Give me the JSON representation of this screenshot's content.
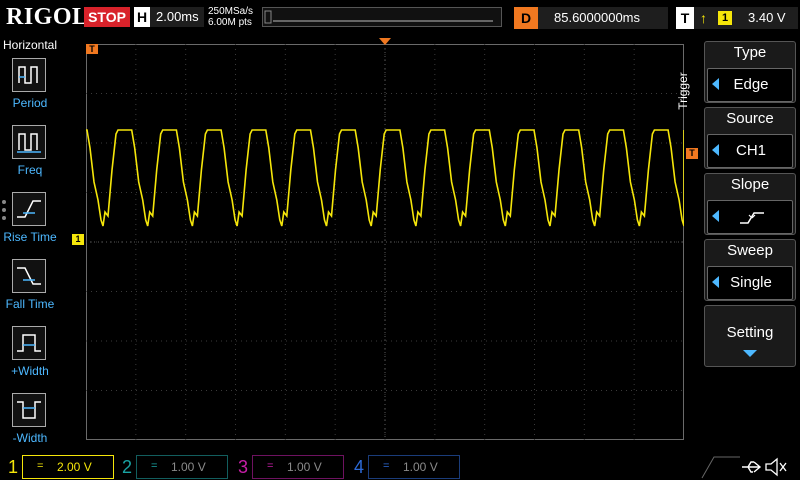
{
  "header": {
    "brand": "RIGOL",
    "run_state": "STOP",
    "horizontal_label": "H",
    "timebase": "2.00ms",
    "sample_rate": "250MSa/s",
    "memory_depth": "6.00M pts",
    "delay_label": "D",
    "delay_value": "85.6000000ms",
    "trigger_label": "T",
    "trigger_channel": "1",
    "trigger_level": "3.40 V"
  },
  "left_menu": {
    "title": "Horizontal",
    "items": [
      {
        "label": "Period",
        "icon": "period-icon"
      },
      {
        "label": "Freq",
        "icon": "frequency-icon"
      },
      {
        "label": "Rise Time",
        "icon": "rise-time-icon"
      },
      {
        "label": "Fall Time",
        "icon": "fall-time-icon"
      },
      {
        "label": "+Width",
        "icon": "positive-width-icon"
      },
      {
        "label": "-Width",
        "icon": "negative-width-icon"
      }
    ]
  },
  "right_menu": {
    "side_label": "Trigger",
    "buttons": [
      {
        "title": "Type",
        "value": "Edge"
      },
      {
        "title": "Source",
        "value": "CH1"
      },
      {
        "title": "Slope",
        "value": ""
      },
      {
        "title": "Sweep",
        "value": "Single"
      }
    ],
    "setting_label": "Setting"
  },
  "channels": [
    {
      "number": "1",
      "coupling": "=",
      "scale": "2.00 V",
      "color": "#f5e60a",
      "active": true
    },
    {
      "number": "2",
      "coupling": "=",
      "scale": "1.00 V",
      "color": "#19a3a3",
      "active": false
    },
    {
      "number": "3",
      "coupling": "=",
      "scale": "1.00 V",
      "color": "#c81ea8",
      "active": false
    },
    {
      "number": "4",
      "coupling": "=",
      "scale": "1.00 V",
      "color": "#2c6ad8",
      "active": false
    }
  ],
  "markers": {
    "channel1_ground": "1",
    "trigger_level_marker": "T",
    "trigger_position_marker": "T"
  },
  "colors": {
    "ch1": "#f5e60a",
    "trigger": "#f07820",
    "accent": "#4db8ff",
    "stop": "#d8222a"
  }
}
